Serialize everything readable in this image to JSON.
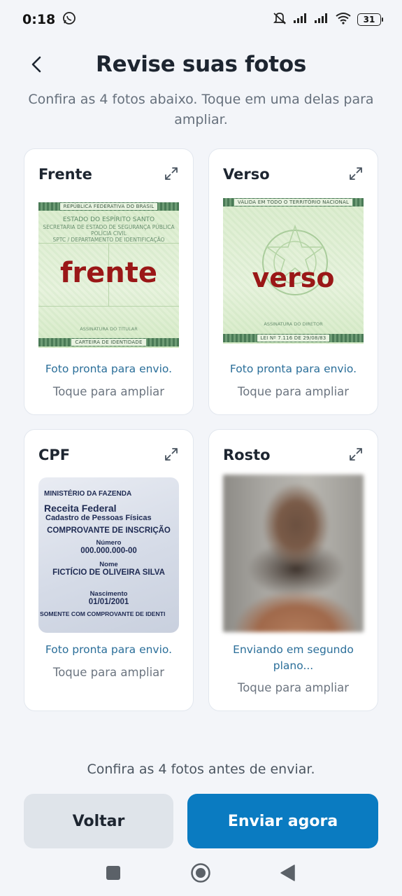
{
  "status_bar": {
    "time": "0:18",
    "battery": "31",
    "icons": [
      "whatsapp-icon",
      "mute-icon",
      "signal-icon",
      "signal-icon",
      "wifi-icon",
      "battery-icon"
    ]
  },
  "header": {
    "title": "Revise suas fotos",
    "back_icon": "chevron-left-icon"
  },
  "subtitle": "Confira as 4 fotos abaixo. Toque em uma delas para ampliar.",
  "cards": [
    {
      "title": "Frente",
      "status": "Foto pronta para envio.",
      "hint": "Toque para ampliar",
      "photo": {
        "top_band": "REPÚBLICA FEDERATIVA DO BRASIL",
        "lines": [
          "ESTADO DO ESPÍRITO SANTO",
          "SECRETARIA DE ESTADO DE SEGURANÇA PÚBLICA",
          "POLÍCIA CIVIL",
          "SPTC / DEPARTAMENTO DE IDENTIFICAÇÃO"
        ],
        "label": "frente",
        "signature": "ASSINATURA DO TITULAR",
        "bottom_band": "CARTEIRA DE IDENTIDADE"
      }
    },
    {
      "title": "Verso",
      "status": "Foto pronta para envio.",
      "hint": "Toque para ampliar",
      "photo": {
        "top_band": "VÁLIDA EM TODO O TERRITÓRIO NACIONAL",
        "label": "verso",
        "signature": "ASSINATURA DO DIRETOR",
        "bottom_band": "LEI Nº 7.116 DE 29/08/83"
      }
    },
    {
      "title": "CPF",
      "status": "Foto pronta para envio.",
      "hint": "Toque para ampliar",
      "photo": {
        "ministry": "MINISTÉRIO DA FAZENDA",
        "agency": "Receita Federal",
        "registry": "Cadastro de Pessoas Físicas",
        "doc_title": "COMPROVANTE DE INSCRIÇÃO",
        "number_label": "Número",
        "number": "000.000.000-00",
        "name_label": "Nome",
        "name": "FICTÍCIO DE OLIVEIRA SILVA",
        "birth_label": "Nascimento",
        "birth": "01/01/2001",
        "footer": "SOMENTE COM COMPROVANTE DE IDENTI"
      }
    },
    {
      "title": "Rosto",
      "status": "Enviando em segundo plano...",
      "hint": "Toque para ampliar"
    }
  ],
  "footer_note": "Confira as 4 fotos antes de enviar.",
  "buttons": {
    "back": "Voltar",
    "send": "Enviar agora"
  },
  "colors": {
    "primary": "#0a7bc1",
    "status_text": "#2a6e99",
    "background": "#f3f5f9"
  }
}
